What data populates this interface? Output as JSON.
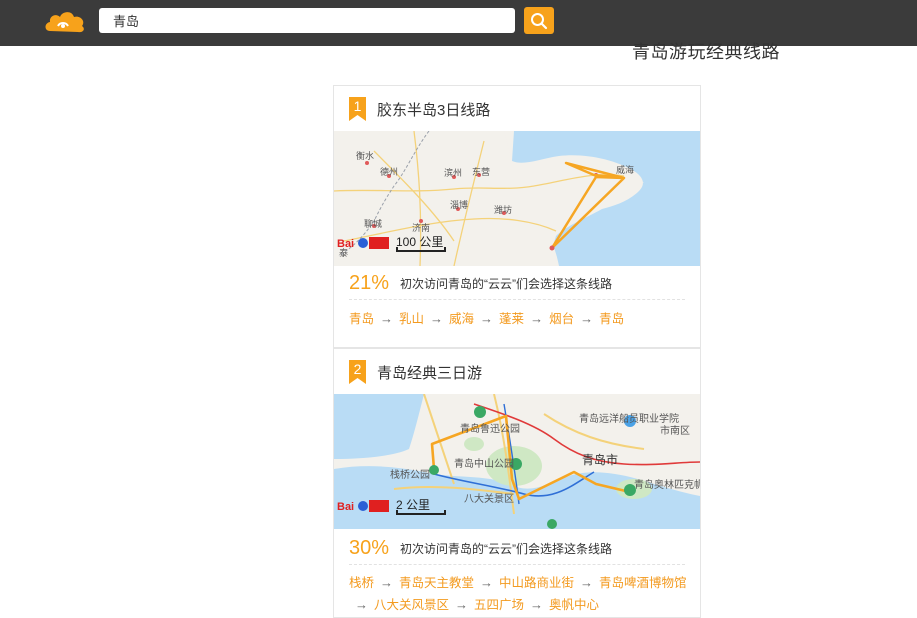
{
  "search": {
    "value": "青岛"
  },
  "page_heading": "青岛游玩经典线路",
  "colors": {
    "accent": "#f7a21b",
    "topbar": "#3b3b3b"
  },
  "routes": [
    {
      "rank": "1",
      "title": "胶东半岛3日线路",
      "percent": "21%",
      "stat_text": "初次访问青岛的“云云”们会选择这条线路",
      "scale": "100 公里",
      "map_labels": [
        "衡水",
        "德州",
        "滨州",
        "东营",
        "济南",
        "淄博",
        "潍坊",
        "威海",
        "聊城",
        "泰"
      ],
      "stops": [
        "青岛",
        "乳山",
        "威海",
        "蓬莱",
        "烟台",
        "青岛"
      ]
    },
    {
      "rank": "2",
      "title": "青岛经典三日游",
      "percent": "30%",
      "stat_text": "初次访问青岛的“云云”们会选择这条线路",
      "scale": "2 公里",
      "map_labels": [
        "青岛远洋船员职业学院",
        "市南区",
        "青岛市",
        "青岛中山公园",
        "青岛鲁迅公园",
        "栈桥公园",
        "八大关景区",
        "青岛奥林匹克帆船中心"
      ],
      "stops": [
        "栈桥",
        "青岛天主教堂",
        "中山路商业街",
        "青岛啤酒博物馆",
        "八大关风景区",
        "五四广场",
        "奥帆中心"
      ]
    }
  ],
  "map_brand": "Bai地图"
}
